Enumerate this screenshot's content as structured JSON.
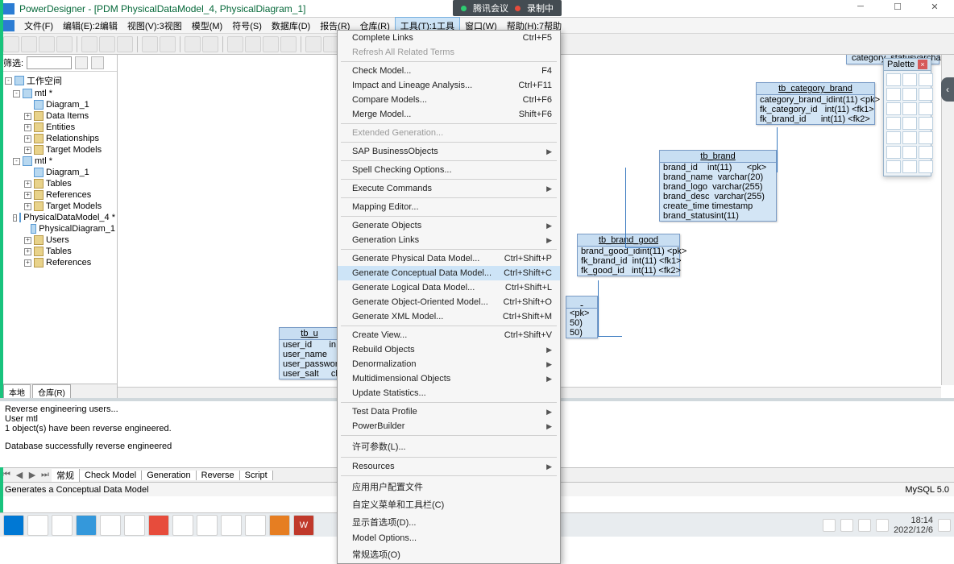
{
  "title": "PowerDesigner - [PDM PhysicalDataModel_4, PhysicalDiagram_1]",
  "meeting": {
    "label": "腾讯会议",
    "rec": "录制中"
  },
  "menubar": [
    "文件(F)",
    "编辑(E):2编辑",
    "视图(V):3视图",
    "模型(M)",
    "符号(S)",
    "数据库(D)",
    "报告(R)",
    "仓库(R)",
    "工具(T):1工具",
    "窗口(W)",
    "帮助(H):7帮助"
  ],
  "filter_label": "筛选:",
  "tree": [
    {
      "lvl": 0,
      "tw": "-",
      "icon": "model",
      "label": "工作空间"
    },
    {
      "lvl": 1,
      "tw": "-",
      "icon": "model",
      "label": "mtl *"
    },
    {
      "lvl": 2,
      "tw": "",
      "icon": "model",
      "label": "Diagram_1"
    },
    {
      "lvl": 2,
      "tw": "+",
      "icon": "fold",
      "label": "Data Items"
    },
    {
      "lvl": 2,
      "tw": "+",
      "icon": "fold",
      "label": "Entities"
    },
    {
      "lvl": 2,
      "tw": "+",
      "icon": "fold",
      "label": "Relationships"
    },
    {
      "lvl": 2,
      "tw": "+",
      "icon": "fold",
      "label": "Target Models"
    },
    {
      "lvl": 1,
      "tw": "-",
      "icon": "model",
      "label": "mtl *"
    },
    {
      "lvl": 2,
      "tw": "",
      "icon": "model",
      "label": "Diagram_1"
    },
    {
      "lvl": 2,
      "tw": "+",
      "icon": "fold",
      "label": "Tables"
    },
    {
      "lvl": 2,
      "tw": "+",
      "icon": "fold",
      "label": "References"
    },
    {
      "lvl": 2,
      "tw": "+",
      "icon": "fold",
      "label": "Target Models"
    },
    {
      "lvl": 1,
      "tw": "-",
      "icon": "model",
      "label": "PhysicalDataModel_4 *"
    },
    {
      "lvl": 2,
      "tw": "",
      "icon": "model",
      "label": "PhysicalDiagram_1"
    },
    {
      "lvl": 2,
      "tw": "+",
      "icon": "fold",
      "label": "Users"
    },
    {
      "lvl": 2,
      "tw": "+",
      "icon": "fold",
      "label": "Tables"
    },
    {
      "lvl": 2,
      "tw": "+",
      "icon": "fold",
      "label": "References"
    }
  ],
  "bottom_tabs": [
    "本地",
    "仓库(R)"
  ],
  "palette_title": "Palette",
  "dropdown": [
    {
      "t": "Complete Links",
      "s": "Ctrl+F5"
    },
    {
      "t": "Refresh All Related Terms",
      "disabled": true
    },
    {
      "sep": true
    },
    {
      "t": "Check Model...",
      "s": "F4"
    },
    {
      "t": "Impact and Lineage Analysis...",
      "s": "Ctrl+F11"
    },
    {
      "t": "Compare Models...",
      "s": "Ctrl+F6"
    },
    {
      "t": "Merge Model...",
      "s": "Shift+F6"
    },
    {
      "sep": true
    },
    {
      "t": "Extended Generation...",
      "disabled": true
    },
    {
      "sep": true
    },
    {
      "t": "SAP BusinessObjects",
      "sub": true
    },
    {
      "sep": true
    },
    {
      "t": "Spell Checking Options..."
    },
    {
      "sep": true
    },
    {
      "t": "Execute Commands",
      "sub": true
    },
    {
      "sep": true
    },
    {
      "t": "Mapping Editor..."
    },
    {
      "sep": true
    },
    {
      "t": "Generate Objects",
      "sub": true
    },
    {
      "t": "Generation Links",
      "sub": true
    },
    {
      "sep": true
    },
    {
      "t": "Generate Physical Data Model...",
      "s": "Ctrl+Shift+P"
    },
    {
      "t": "Generate Conceptual Data Model...",
      "s": "Ctrl+Shift+C",
      "hl": true
    },
    {
      "t": "Generate Logical Data Model...",
      "s": "Ctrl+Shift+L"
    },
    {
      "t": "Generate Object-Oriented Model...",
      "s": "Ctrl+Shift+O"
    },
    {
      "t": "Generate XML Model...",
      "s": "Ctrl+Shift+M"
    },
    {
      "sep": true
    },
    {
      "t": "Create View...",
      "s": "Ctrl+Shift+V"
    },
    {
      "t": "Rebuild Objects",
      "sub": true
    },
    {
      "t": "Denormalization",
      "sub": true
    },
    {
      "t": "Multidimensional Objects",
      "sub": true
    },
    {
      "t": "Update Statistics..."
    },
    {
      "sep": true
    },
    {
      "t": "Test Data Profile",
      "sub": true
    },
    {
      "t": "PowerBuilder",
      "sub": true
    },
    {
      "sep": true
    },
    {
      "t": "许可参数(L)..."
    },
    {
      "sep": true
    },
    {
      "t": "Resources",
      "sub": true
    },
    {
      "sep": true
    },
    {
      "t": "应用用户配置文件"
    },
    {
      "t": "自定义菜单和工具栏(C)"
    },
    {
      "t": "显示首选项(D)..."
    },
    {
      "t": "Model Options..."
    },
    {
      "t": "常规选项(O)"
    }
  ],
  "entities": {
    "tb_user": {
      "name": "tb_u",
      "rows": [
        "user_id       in",
        "user_name     va",
        "user_passwordch",
        "user_salt     ch"
      ]
    },
    "tb_brand": {
      "name": "tb_brand",
      "rows": [
        "brand_id    int(11)      <pk>",
        "brand_name  varchar(20)",
        "brand_logo  varchar(255)",
        "brand_desc  varchar(255)",
        "create_time timestamp",
        "brand_statusint(11)"
      ]
    },
    "tb_brand_good": {
      "name": "tb_brand_good",
      "rows": [
        "brand_good_idint(11) <pk>",
        "fk_brand_id  int(11) <fk1>",
        "fk_good_id   int(11) <fk2>"
      ]
    },
    "tb_category_brand": {
      "name": "tb_category_brand",
      "rows": [
        "category_brand_idint(11) <pk>",
        "fk_category_id   int(11) <fk1>",
        "fk_brand_id      int(11) <fk2>"
      ]
    },
    "frag1": {
      "rows": [
        "<pk>",
        "50)",
        "50)"
      ]
    },
    "frag2": {
      "rows": [
        "category_statusvarcha"
      ]
    }
  },
  "output": {
    "lines": [
      "Reverse engineering users...",
      "User mtl",
      "1 object(s) have been reverse engineered.",
      "",
      "Database successfully reverse engineered"
    ],
    "tabs": [
      "常规",
      "Check Model",
      "Generation",
      "Reverse",
      "Script"
    ]
  },
  "status": {
    "left": "Generates a Conceptual Data Model",
    "right": "MySQL 5.0"
  },
  "tray": {
    "time": "18:14",
    "date": "2022/12/6"
  }
}
